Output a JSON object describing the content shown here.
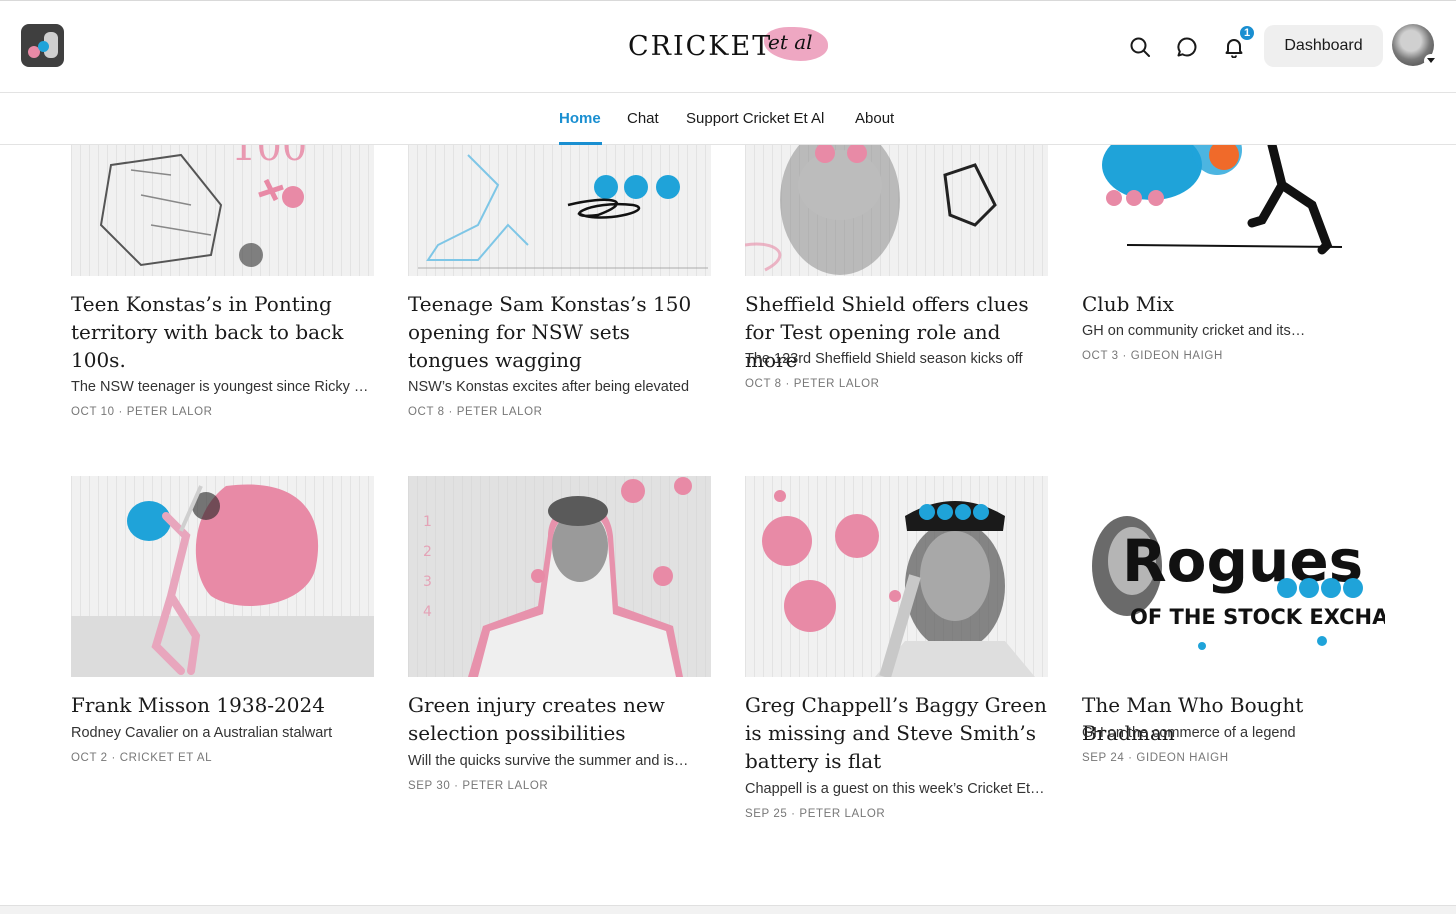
{
  "header": {
    "logo_text_main": "CRICKET",
    "logo_text_script": "et al",
    "dashboard_label": "Dashboard",
    "notification_count": "1"
  },
  "nav": {
    "items": [
      "Home",
      "Chat",
      "Support Cricket Et Al",
      "About"
    ],
    "active": "Home"
  },
  "posts": [
    {
      "title": "Teen Konstas’s in Ponting territory with back to back 100s.",
      "subtitle": "The NSW teenager is youngest since Ricky Ponting",
      "date": "OCT 10",
      "author": "PETER LALOR"
    },
    {
      "title": "Teenage Sam Konstas’s 150 opening for NSW sets tongues wagging",
      "subtitle": "NSW’s Konstas excites after being elevated",
      "date": "OCT 8",
      "author": "PETER LALOR"
    },
    {
      "title": "Sheffield Shield offers clues for Test opening role and more",
      "subtitle": "The 123rd Sheffield Shield season kicks off",
      "date": "OCT 8",
      "author": "PETER LALOR"
    },
    {
      "title": "Club Mix",
      "subtitle": "GH on community cricket and its…",
      "date": "OCT 3",
      "author": "GIDEON HAIGH"
    },
    {
      "title": "Frank Misson 1938-2024",
      "subtitle": "Rodney Cavalier on a Australian stalwart",
      "date": "OCT 2",
      "author": "CRICKET ET AL"
    },
    {
      "title": "Green injury creates new selection possibilities",
      "subtitle": "Will the quicks survive the summer and is…",
      "date": "SEP 30",
      "author": "PETER LALOR"
    },
    {
      "title": "Greg Chappell’s Baggy Green is missing and Steve Smith’s battery is flat",
      "subtitle": "Chappell is a guest on this week’s Cricket Et Al",
      "date": "SEP 25",
      "author": "PETER LALOR"
    },
    {
      "title": "The Man Who Bought Bradman",
      "subtitle": "GH on the commerce of a legend",
      "date": "SEP 24",
      "author": "GIDEON HAIGH"
    }
  ],
  "thumb_texts": {
    "rogues_word": "Rogues",
    "rogues_caption": "OF THE STOCK EXCHANGE"
  },
  "colors": {
    "accent": "#1a8fd1",
    "pink": "#e88aa6",
    "blue": "#1fa3d9",
    "orange": "#f06a2a"
  },
  "icons": [
    "search-icon",
    "chat-bubble-icon",
    "bell-icon",
    "chevron-down-icon"
  ]
}
